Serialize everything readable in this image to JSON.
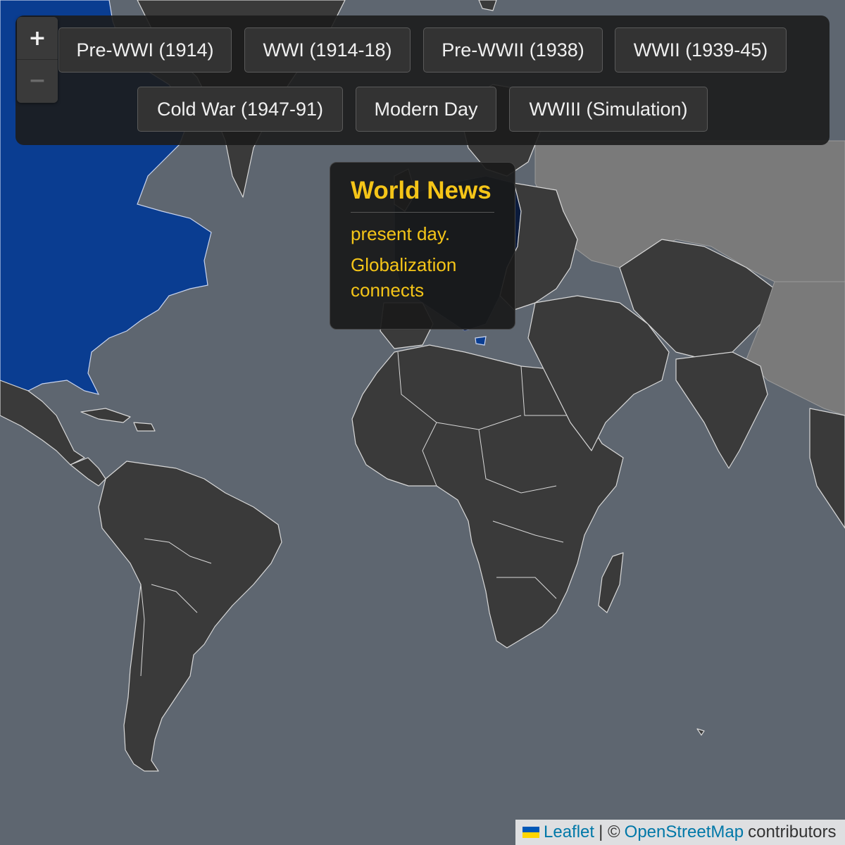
{
  "zoom": {
    "in_label": "+",
    "out_label": "−"
  },
  "era_buttons": [
    "Pre-WWI (1914)",
    "WWI (1914-18)",
    "Pre-WWII (1938)",
    "WWII (1939-45)",
    "Cold War (1947-91)",
    "Modern Day",
    "WWIII (Simulation)"
  ],
  "news": {
    "title": "World News",
    "line1": "present day.",
    "line2": "Globalization connects"
  },
  "attribution": {
    "leaflet": "Leaflet",
    "separator": "| ©",
    "osm": "OpenStreetMap",
    "suffix": "contributors"
  },
  "colors": {
    "ocean": "#5e6670",
    "land": "#3a3a3a",
    "highlight_blue": "#0a3d91",
    "highlight_grey": "#7a7a7a",
    "accent_yellow": "#f5c518"
  }
}
